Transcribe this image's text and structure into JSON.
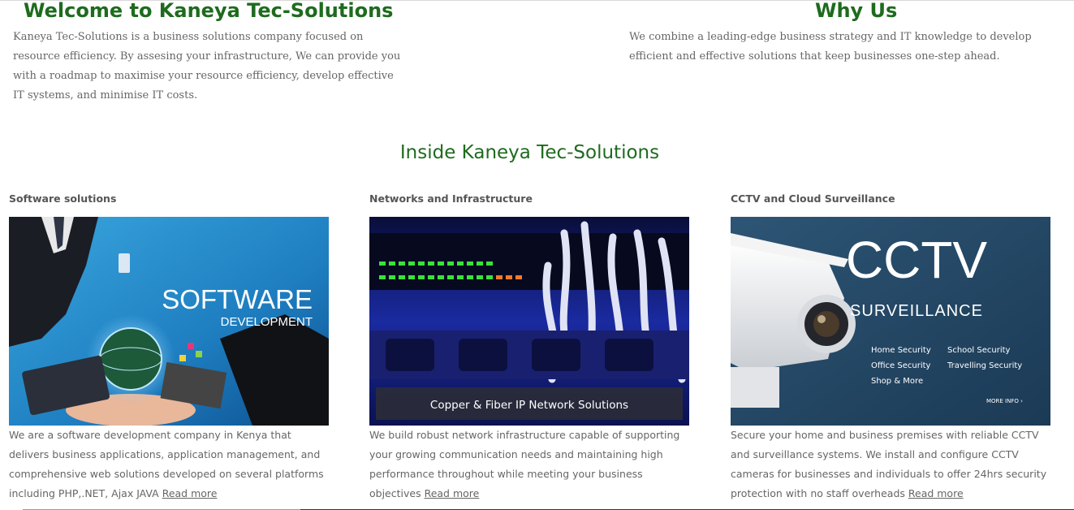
{
  "welcome": {
    "heading": "Welcome to Kaneya Tec-Solutions",
    "text": "Kaneya Tec-Solutions is a business solutions company focused on resource efficiency. By assesing your infrastructure, We can provide you with a roadmap to maximise your resource efficiency, develop effective IT systems, and minimise IT costs."
  },
  "why": {
    "heading": "Why Us",
    "text": "We combine a leading-edge business strategy and IT knowledge to develop efficient and effective solutions that keep businesses one-step ahead."
  },
  "inside": {
    "heading": "Inside Kaneya Tec-Solutions"
  },
  "cards": [
    {
      "title": "Software solutions",
      "image_text": [
        "SOFTWARE",
        "DEVELOPMENT"
      ],
      "text": "We are a software development company in Kenya that delivers business applications, application management, and comprehensive web solutions developed on several platforms including PHP,.NET, Ajax JAVA ",
      "read_more": "Read more"
    },
    {
      "title": "Networks and Infrastructure",
      "image_text": [
        "Copper & Fiber IP Network Solutions"
      ],
      "text": "We build robust network infrastructure capable of supporting your growing communication needs and maintaining high performance throughout while meeting your business objectives ",
      "read_more": "Read more"
    },
    {
      "title": "CCTV and Cloud Surveillance",
      "image_text": [
        "CCTV",
        "SURVEILLANCE",
        "Home Security",
        "School Security",
        "Office Security",
        "Travelling Security",
        "Shop & More",
        "MORE INFO ›"
      ],
      "text": "Secure your home and business premises with reliable CCTV and surveillance systems. We install and configure CCTV cameras for businesses and individuals to offer 24hrs security protection with no staff overheads ",
      "read_more": "Read more"
    }
  ],
  "colors": {
    "heading_green": "#1e6b1e",
    "body_text": "#666666"
  }
}
